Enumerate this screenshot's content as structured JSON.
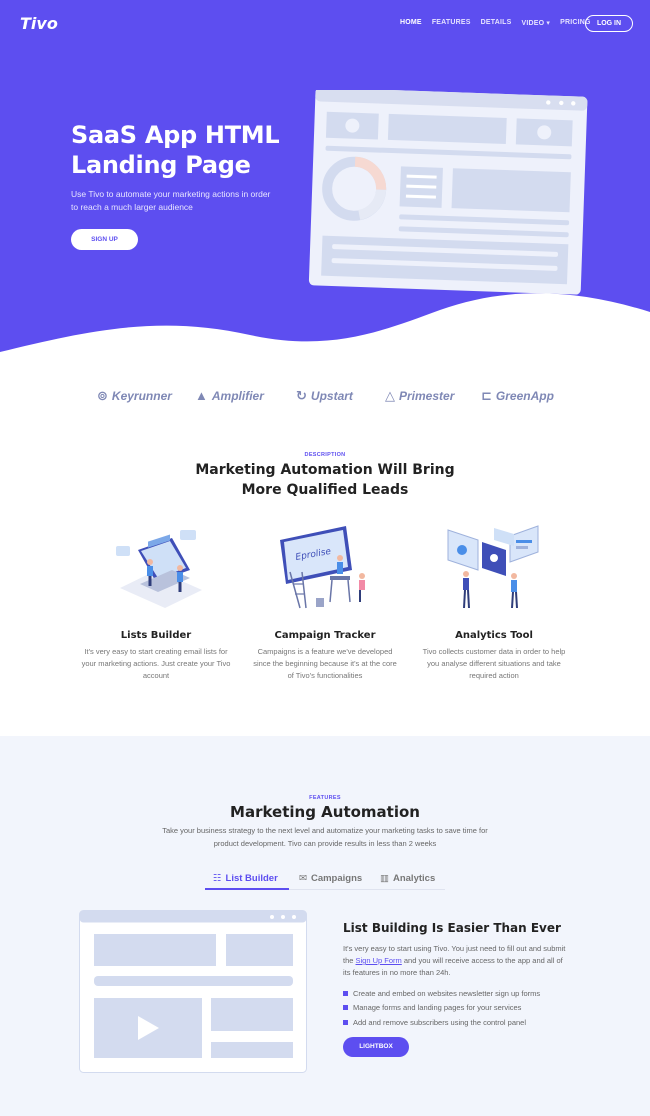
{
  "nav": {
    "logo": "Tivo",
    "links": [
      "HOME",
      "FEATURES",
      "DETAILS",
      "VIDEO ▾",
      "PRICING"
    ],
    "login": "LOG IN"
  },
  "hero": {
    "title": "SaaS App HTML Landing Page",
    "subtitle": "Use Tivo to automate your marketing actions in order to reach a much larger audience",
    "cta": "SIGN UP"
  },
  "logos": [
    "Keyrunner",
    "Amplifier",
    "Upstart",
    "Primester",
    "GreenApp"
  ],
  "description": {
    "eyebrow": "DESCRIPTION",
    "title_line1": "Marketing Automation Will Bring",
    "title_line2": "More Qualified Leads",
    "features": [
      {
        "title": "Lists Builder",
        "text": "It's very easy to start creating email lists for your marketing actions. Just create your Tivo account"
      },
      {
        "title": "Campaign Tracker",
        "text": "Campaigns is a feature we've developed since the beginning because it's at the core of Tivo's functionalities"
      },
      {
        "title": "Analytics Tool",
        "text": "Tivo collects customer data in order to help you analyse different situations and take required action"
      }
    ]
  },
  "features": {
    "eyebrow": "FEATURES",
    "title": "Marketing Automation",
    "subtitle": "Take your business strategy to the next level and automatize your marketing tasks to save time for product development. Tivo can provide results in less than 2 weeks",
    "tabs": [
      {
        "label": "List Builder",
        "icon": "list-icon"
      },
      {
        "label": "Campaigns",
        "icon": "envelope-icon"
      },
      {
        "label": "Analytics",
        "icon": "bar-chart-icon"
      }
    ],
    "panel": {
      "title": "List Building Is Easier Than Ever",
      "text_before": "It's very easy to start using Tivo. You just need to fill out and submit the ",
      "link": "Sign Up Form",
      "text_after": " and you will receive access to the app and all of its features in no more than 24h.",
      "bullets": [
        "Create and embed on websites newsletter sign up forms",
        "Manage forms and landing pages for your services",
        "Add and remove subscribers using the control panel"
      ],
      "cta": "LIGHTBOX"
    }
  },
  "colors": {
    "primary": "#5d4ef0",
    "light_bg": "#f2f5fc",
    "placeholder": "#d3dbef"
  }
}
